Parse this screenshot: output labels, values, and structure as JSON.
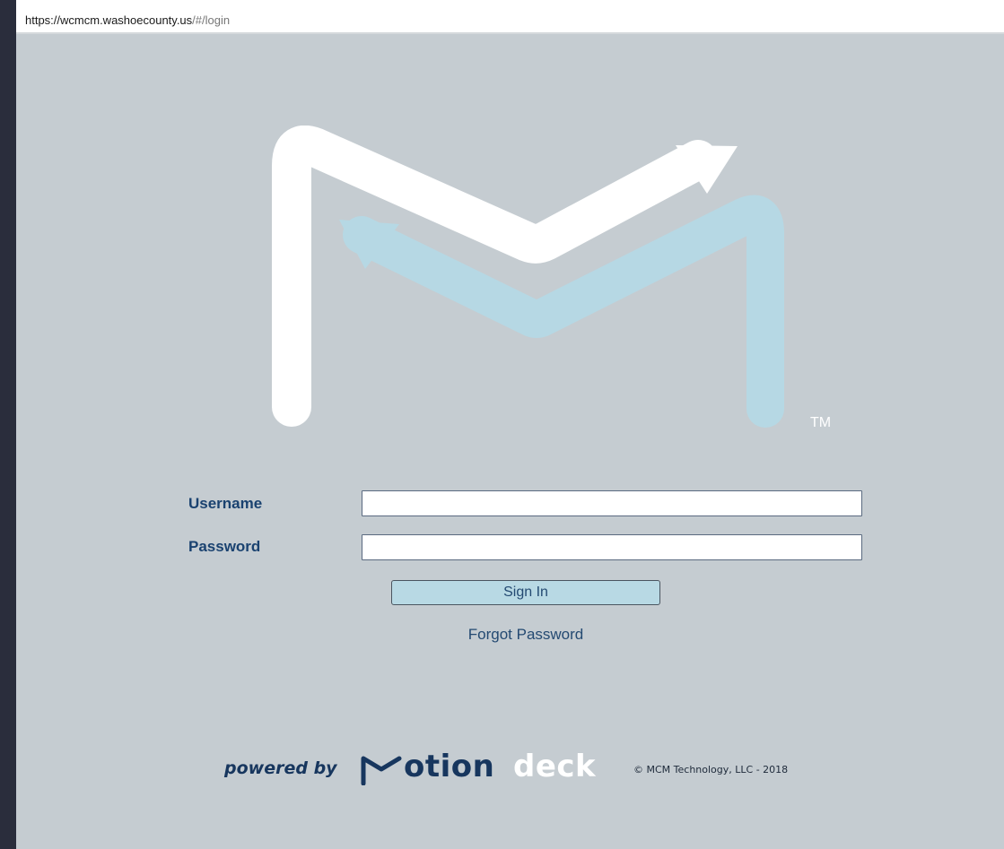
{
  "browser": {
    "url_host": "https://wcmcm.washoecounty.us",
    "url_path": "/#/login"
  },
  "logo": {
    "icon": "motiondeck-m-logo",
    "trademark": "TM",
    "colors": {
      "white": "#ffffff",
      "light_blue": "#b6d8e4"
    }
  },
  "login": {
    "username_label": "Username",
    "username_value": "",
    "password_label": "Password",
    "password_value": "",
    "sign_in_label": "Sign In",
    "forgot_password_label": "Forgot Password"
  },
  "footer": {
    "powered_by": "powered by",
    "brand_part1": "otion",
    "brand_part2": "deck",
    "copyright": "© MCM Technology, LLC - 2018"
  },
  "colors": {
    "page_background": "#c5ccd1",
    "label_text": "#1a4270",
    "button_fill": "#b8d9e4"
  }
}
